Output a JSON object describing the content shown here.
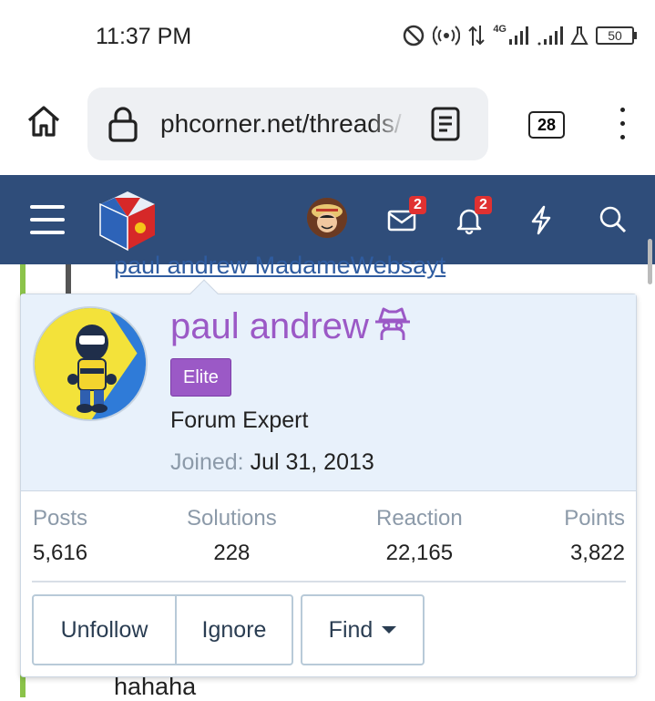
{
  "status_bar": {
    "time": "11:37 PM",
    "network_label": "4G",
    "battery": "50"
  },
  "browser": {
    "url": "phcorner.net/threads/",
    "tab_count": "28"
  },
  "forum_nav": {
    "inbox_badge": "2",
    "alerts_badge": "2"
  },
  "background": {
    "quote_line": "paul andrew MadameWebsayt",
    "post_text": "hahaha"
  },
  "profile_card": {
    "username": "paul andrew",
    "banner": "Elite",
    "user_title": "Forum Expert",
    "joined_label": "Joined:",
    "joined_date": "Jul 31, 2013",
    "stats": [
      {
        "label": "Posts",
        "value": "5,616"
      },
      {
        "label": "Solutions",
        "value": "228"
      },
      {
        "label": "Reaction",
        "value": "22,165"
      },
      {
        "label": "Points",
        "value": "3,822"
      }
    ],
    "buttons": {
      "unfollow": "Unfollow",
      "ignore": "Ignore",
      "find": "Find"
    }
  },
  "colors": {
    "nav_bg": "#2f4d7a",
    "username": "#9b59c6",
    "badge": "#e03131",
    "card_header": "#e8f1fb"
  }
}
